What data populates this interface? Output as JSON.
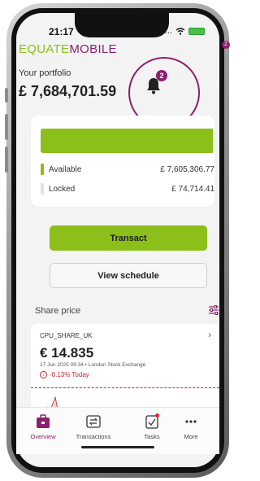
{
  "status_bar": {
    "time": "21:17",
    "signal": "....",
    "wifi": "wifi"
  },
  "brand": {
    "part1": "EQUATE",
    "part2": "MOBILE"
  },
  "header": {
    "corner_badge": "2",
    "portfolio_label": "Your portfolio",
    "portfolio_value": "£ 7,684,701.59",
    "notification_count": "2"
  },
  "balance": {
    "available_fraction": 0.99,
    "available_label": "Available",
    "available_value": "£ 7,605,306.77",
    "locked_label": "Locked",
    "locked_value": "£ 74,714.41"
  },
  "actions": {
    "transact_label": "Transact",
    "schedule_label": "View schedule"
  },
  "share_price": {
    "section_title": "Share price",
    "ticker": "CPU_SHARE_UK",
    "chevron": "›",
    "price": "€ 14.835",
    "meta": "17 Jun 2025 09:34 • London Stock Exchange",
    "change_arrow": "↓",
    "change": "-0.13% Today"
  },
  "nav": {
    "items": [
      {
        "label": "Overview",
        "icon": "briefcase-icon",
        "active": true
      },
      {
        "label": "Transactions",
        "icon": "transactions-icon",
        "active": false
      },
      {
        "label": "Tasks",
        "icon": "tasks-icon",
        "active": false
      },
      {
        "label": "More",
        "icon": "more-icon",
        "active": false
      }
    ]
  },
  "colors": {
    "brand_green": "#8cbf1a",
    "brand_purple": "#8c1f6b",
    "negative_red": "#c0272d"
  }
}
